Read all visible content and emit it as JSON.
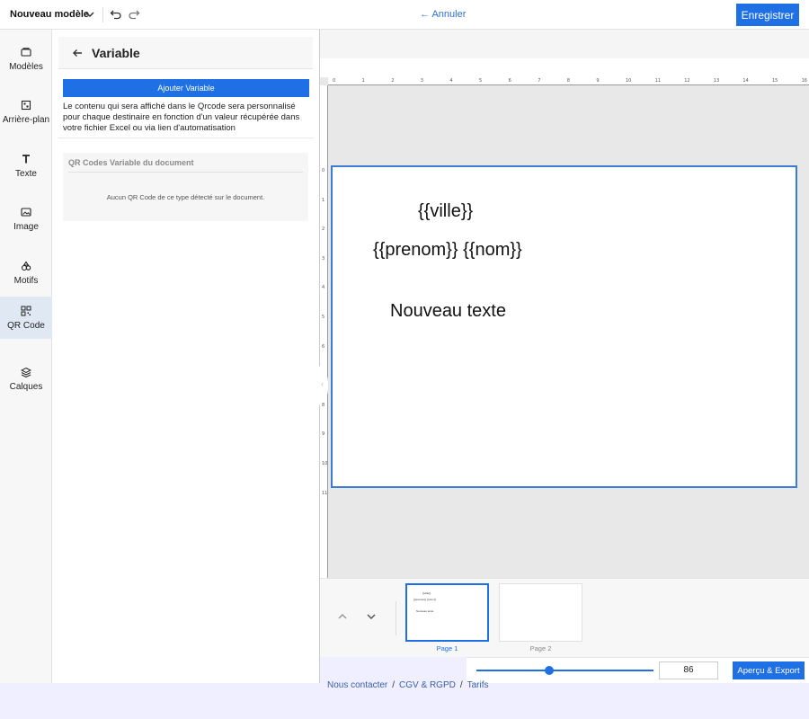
{
  "header": {
    "doc_title": "Nouveau modèle",
    "cancel_label": "Annuler",
    "save_label": "Enregistrer"
  },
  "sidebar": {
    "items": [
      {
        "label": "Modèles",
        "icon": "folder-icon"
      },
      {
        "label": "Arrière-plan",
        "icon": "background-grid-icon"
      },
      {
        "label": "Texte",
        "icon": "text-t-icon"
      },
      {
        "label": "Image",
        "icon": "image-icon"
      },
      {
        "label": "Motifs",
        "icon": "shapes-icon"
      },
      {
        "label": "QR Code",
        "icon": "qr-code-icon",
        "active": true
      },
      {
        "label": "Calques",
        "icon": "layers-icon"
      }
    ]
  },
  "panel": {
    "title": "Variable",
    "add_button": "Ajouter Variable",
    "description": "Le contenu qui sera affiché dans le Qrcode sera personnalisé pour chaque destinaire en fonction d'un valeur récupérée dans votre fichier Excel ou via lien d'automatisation",
    "section_title": "QR Codes Variable du document",
    "empty_message": "Aucun QR Code de ce type détecté sur le document."
  },
  "ruler": {
    "h_ticks": [
      "0",
      "1",
      "2",
      "3",
      "4",
      "5",
      "6",
      "7",
      "8",
      "9",
      "10",
      "11",
      "12",
      "13",
      "14",
      "15",
      "16"
    ],
    "v_ticks": [
      "0",
      "1",
      "2",
      "3",
      "4",
      "5",
      "6",
      "7",
      "8",
      "9",
      "10",
      "11"
    ]
  },
  "canvas": {
    "texts": [
      "{{ville}}",
      "{{prenom}} {{nom}}",
      "Nouveau texte"
    ]
  },
  "pages": [
    {
      "label": "Page 1",
      "active": true
    },
    {
      "label": "Page 2",
      "active": false
    }
  ],
  "zoom": {
    "value": "86",
    "slider_fraction": 0.41
  },
  "export_label": "Aperçu & Export",
  "footer": {
    "links": [
      "Nous contacter",
      "CGV & RGPD",
      "Tarifs"
    ]
  },
  "colors": {
    "accent": "#1f6fe5",
    "active_sidebar": "#dfe8f3"
  }
}
